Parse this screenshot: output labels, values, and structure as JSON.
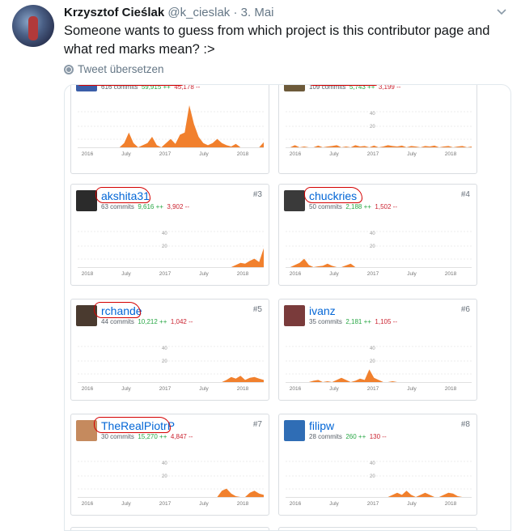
{
  "tweet": {
    "author_name": "Krzysztof Cieślak",
    "handle": "@k_cieslak",
    "separator": "·",
    "date": "3. Mai",
    "text": "Someone wants to guess from which project is this contributor page and what red marks mean? :>",
    "translate_label": "Tweet übersetzen",
    "chevron_icon": "chevron-down-icon"
  },
  "colors": {
    "link": "#0366d6",
    "additions": "#28a745",
    "deletions": "#cb2431",
    "chart_fill": "#f1802d",
    "marker": "#d40000"
  },
  "contributors": [
    {
      "username": "",
      "rank": "",
      "commits": "616 commits",
      "additions": "59,915 ++",
      "deletions": "45,178 --",
      "x_labels": [
        "2016",
        "July",
        "2017",
        "July",
        "2018"
      ],
      "y_labels": [],
      "activity": [
        0,
        0,
        0,
        0,
        0,
        0,
        0,
        0,
        0,
        0,
        0.1,
        0.35,
        0.1,
        0,
        0.05,
        0.1,
        0.25,
        0.05,
        0,
        0.1,
        0.2,
        0.08,
        0.3,
        0.35,
        1.0,
        0.55,
        0.25,
        0.1,
        0.05,
        0.1,
        0.2,
        0.1,
        0.05,
        0.02,
        0.08,
        0,
        0,
        0,
        0,
        0,
        0.12
      ]
    },
    {
      "username": "",
      "rank": "",
      "commits": "109 commits",
      "additions": "5,743 ++",
      "deletions": "3,199 --",
      "x_labels": [
        "2016",
        "July",
        "2017",
        "July",
        "2018"
      ],
      "y_labels": [
        "40",
        "20"
      ],
      "activity": [
        0,
        0,
        0.05,
        0,
        0.02,
        0,
        0,
        0.04,
        0,
        0.02,
        0.03,
        0.05,
        0,
        0.02,
        0,
        0.05,
        0.02,
        0.03,
        0,
        0.04,
        0,
        0.02,
        0.05,
        0.03,
        0.02,
        0.04,
        0,
        0.03,
        0.02,
        0,
        0.03,
        0.02,
        0.04,
        0,
        0.02,
        0.03,
        0,
        0.02,
        0.03,
        0,
        0.02
      ]
    },
    {
      "username": "akshita31",
      "rank": "#3",
      "commits": "63 commits",
      "additions": "9,616 ++",
      "deletions": "3,902 --",
      "x_labels": [
        "2018",
        "July",
        "2017",
        "July",
        "2018"
      ],
      "y_labels": [
        "40",
        "20"
      ],
      "activity": [
        0,
        0,
        0,
        0,
        0,
        0,
        0,
        0,
        0,
        0,
        0,
        0,
        0,
        0,
        0,
        0,
        0,
        0,
        0,
        0,
        0,
        0,
        0,
        0,
        0,
        0,
        0,
        0,
        0,
        0,
        0,
        0,
        0,
        0,
        0.05,
        0.1,
        0.08,
        0.15,
        0.2,
        0.12,
        0.45
      ]
    },
    {
      "username": "chuckries",
      "rank": "#4",
      "commits": "50 commits",
      "additions": "2,188 ++",
      "deletions": "1,502 --",
      "x_labels": [
        "2016",
        "July",
        "2017",
        "July",
        "2018"
      ],
      "y_labels": [
        "40",
        "20"
      ],
      "activity": [
        0,
        0,
        0.05,
        0.1,
        0.2,
        0.05,
        0,
        0.02,
        0.03,
        0.08,
        0.03,
        0,
        0,
        0.04,
        0.08,
        0,
        0,
        0,
        0,
        0,
        0,
        0,
        0,
        0,
        0,
        0,
        0,
        0,
        0,
        0,
        0,
        0,
        0,
        0,
        0,
        0,
        0,
        0,
        0,
        0,
        0
      ]
    },
    {
      "username": "rchande",
      "rank": "#5",
      "commits": "44 commits",
      "additions": "10,212 ++",
      "deletions": "1,042 --",
      "x_labels": [
        "2016",
        "July",
        "2017",
        "July",
        "2018"
      ],
      "y_labels": [
        "40",
        "20"
      ],
      "activity": [
        0,
        0,
        0,
        0,
        0,
        0,
        0,
        0,
        0,
        0,
        0,
        0,
        0,
        0,
        0,
        0,
        0,
        0,
        0,
        0,
        0,
        0,
        0,
        0,
        0,
        0,
        0,
        0,
        0,
        0,
        0,
        0,
        0.05,
        0.12,
        0.08,
        0.15,
        0.05,
        0.1,
        0.12,
        0.08,
        0.05
      ]
    },
    {
      "username": "ivanz",
      "rank": "#6",
      "commits": "35 commits",
      "additions": "2,181 ++",
      "deletions": "1,105 --",
      "x_labels": [
        "2016",
        "July",
        "2017",
        "July",
        "2018"
      ],
      "y_labels": [
        "40",
        "20"
      ],
      "activity": [
        0,
        0,
        0,
        0,
        0,
        0,
        0.03,
        0.05,
        0,
        0.02,
        0,
        0.05,
        0.1,
        0.05,
        0,
        0.03,
        0.08,
        0.05,
        0.3,
        0.1,
        0.05,
        0,
        0,
        0.02,
        0,
        0,
        0,
        0,
        0,
        0,
        0,
        0,
        0,
        0,
        0,
        0,
        0,
        0,
        0,
        0,
        0
      ]
    },
    {
      "username": "TheRealPiotrP",
      "rank": "#7",
      "commits": "30 commits",
      "additions": "15,270 ++",
      "deletions": "4,847 --",
      "x_labels": [
        "2016",
        "July",
        "2017",
        "July",
        "2018"
      ],
      "y_labels": [
        "40",
        "20"
      ],
      "activity": [
        0,
        0,
        0,
        0,
        0,
        0,
        0,
        0,
        0,
        0,
        0,
        0,
        0,
        0,
        0,
        0,
        0,
        0,
        0,
        0,
        0,
        0,
        0,
        0,
        0,
        0,
        0,
        0,
        0,
        0,
        0,
        0.15,
        0.2,
        0.08,
        0.02,
        0,
        0,
        0.1,
        0.15,
        0.08,
        0.05
      ]
    },
    {
      "username": "filipw",
      "rank": "#8",
      "commits": "28 commits",
      "additions": "260 ++",
      "deletions": "130 --",
      "x_labels": [
        "2016",
        "July",
        "2017",
        "July",
        "2018"
      ],
      "y_labels": [
        "40",
        "20"
      ],
      "activity": [
        0,
        0,
        0,
        0,
        0,
        0,
        0,
        0,
        0,
        0,
        0,
        0,
        0,
        0,
        0,
        0,
        0,
        0,
        0,
        0,
        0,
        0,
        0,
        0.05,
        0.1,
        0.05,
        0.15,
        0.05,
        0,
        0.05,
        0.1,
        0.05,
        0,
        0,
        0.05,
        0.1,
        0.08,
        0.02,
        0,
        0,
        0
      ]
    }
  ]
}
